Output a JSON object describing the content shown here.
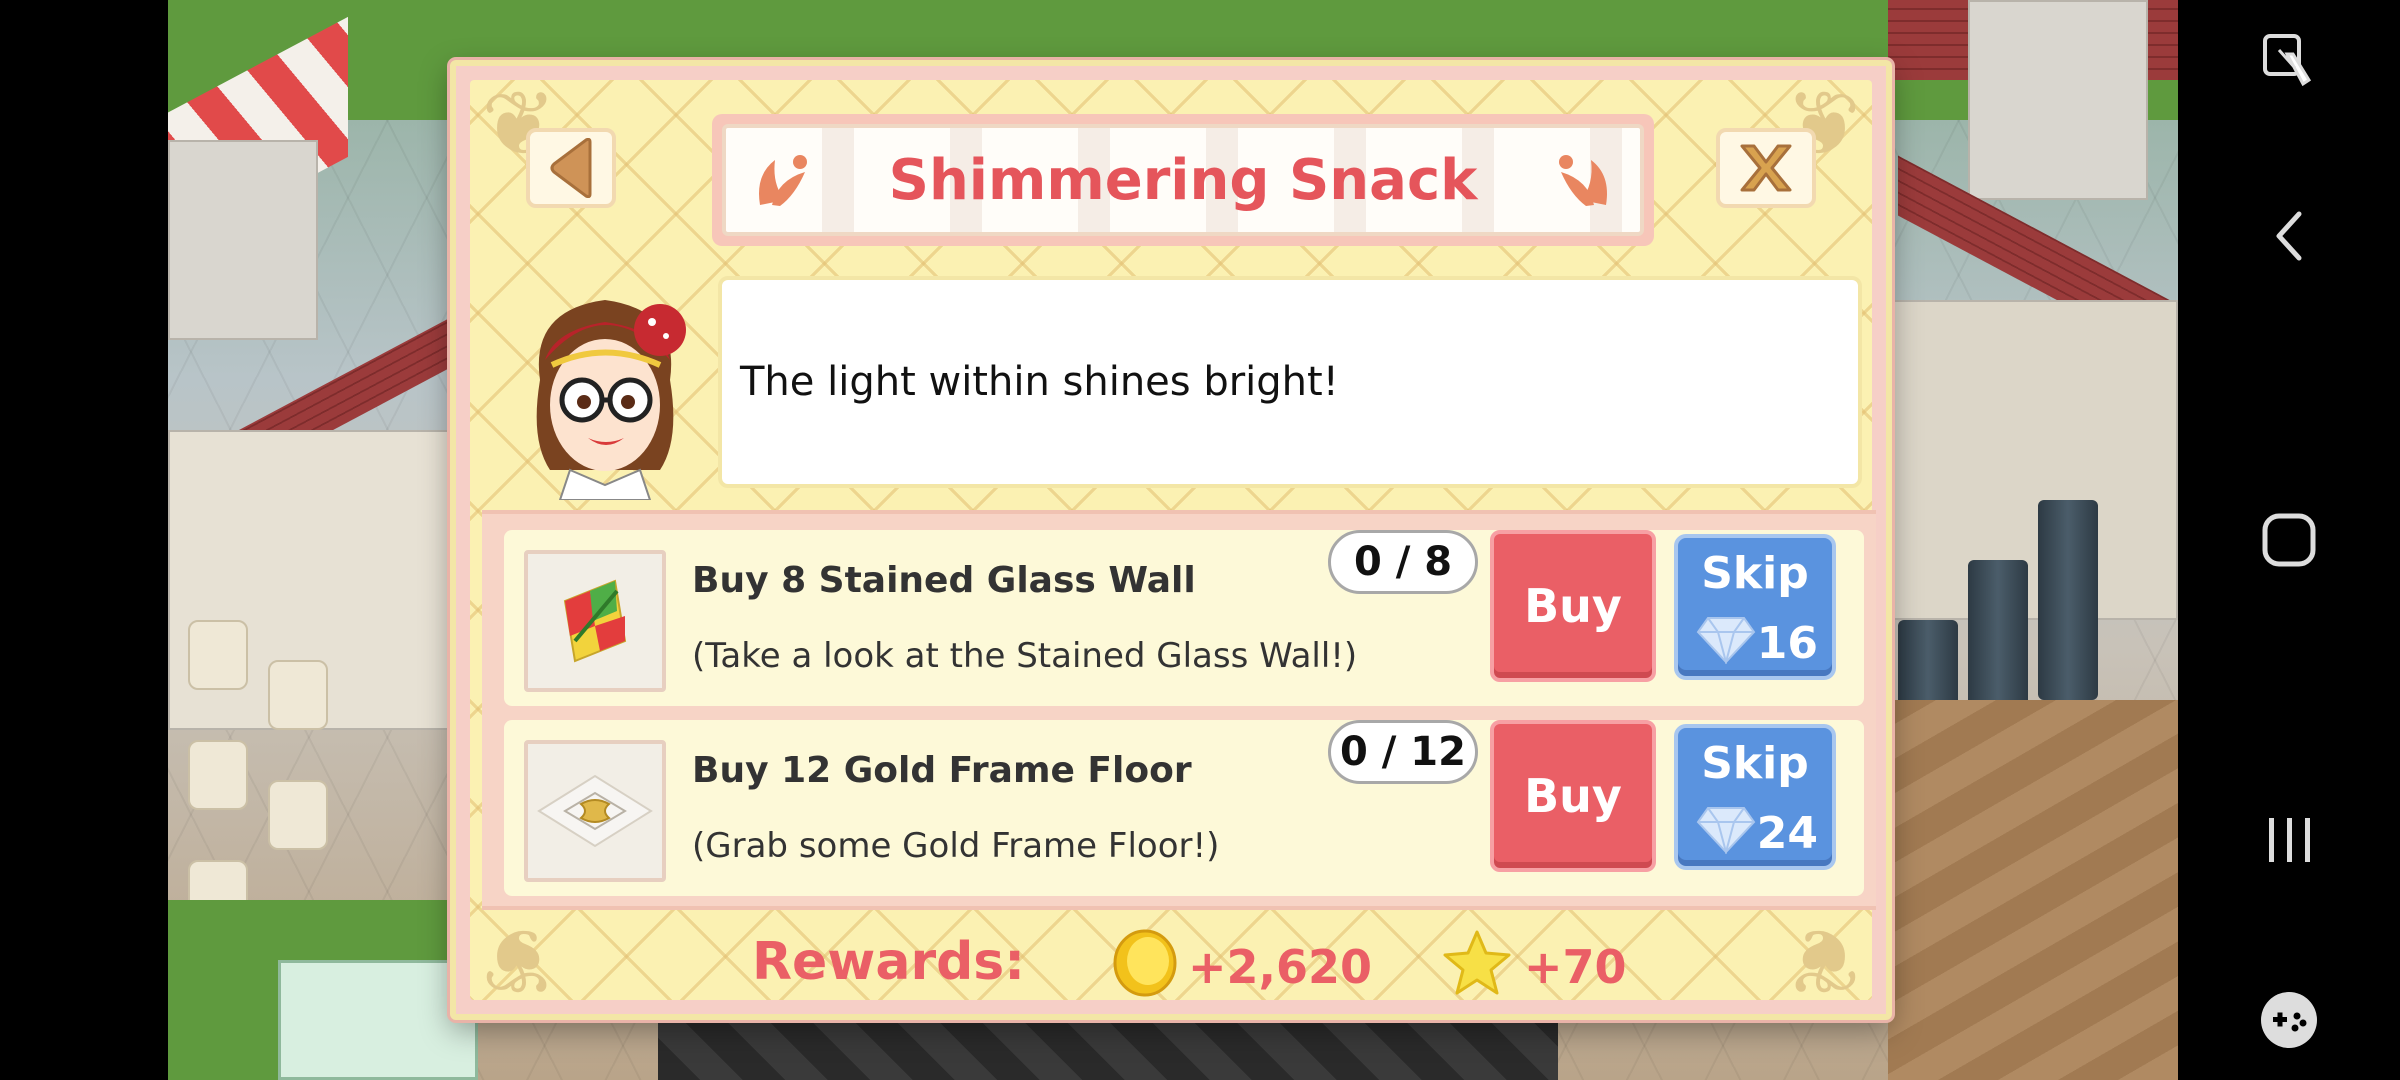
{
  "dialog": {
    "title": "Shimmering Snack",
    "speech": "The light within shines bright!"
  },
  "tasks": [
    {
      "title": "Buy 8 Stained Glass Wall",
      "description": "(Take a look at the Stained Glass Wall!)",
      "progress": "0 / 8",
      "buy_label": "Buy",
      "skip_label": "Skip",
      "skip_cost": "16",
      "icon": "stained-glass-wall-icon"
    },
    {
      "title": "Buy 12 Gold Frame Floor",
      "description": "(Grab some Gold Frame Floor!)",
      "progress": "0 / 12",
      "buy_label": "Buy",
      "skip_label": "Skip",
      "skip_cost": "24",
      "icon": "gold-frame-floor-icon"
    }
  ],
  "rewards": {
    "label": "Rewards:",
    "coins": "+2,620",
    "stars": "+70"
  },
  "colors": {
    "title": "#e5555b",
    "buy": "#ea5f66",
    "skip": "#5a93df",
    "panel": "#fbf1b2"
  },
  "nav_bar": {
    "icons": [
      "screen-assist-icon",
      "back-icon",
      "home-icon",
      "recents-icon",
      "game-tools-icon"
    ]
  }
}
